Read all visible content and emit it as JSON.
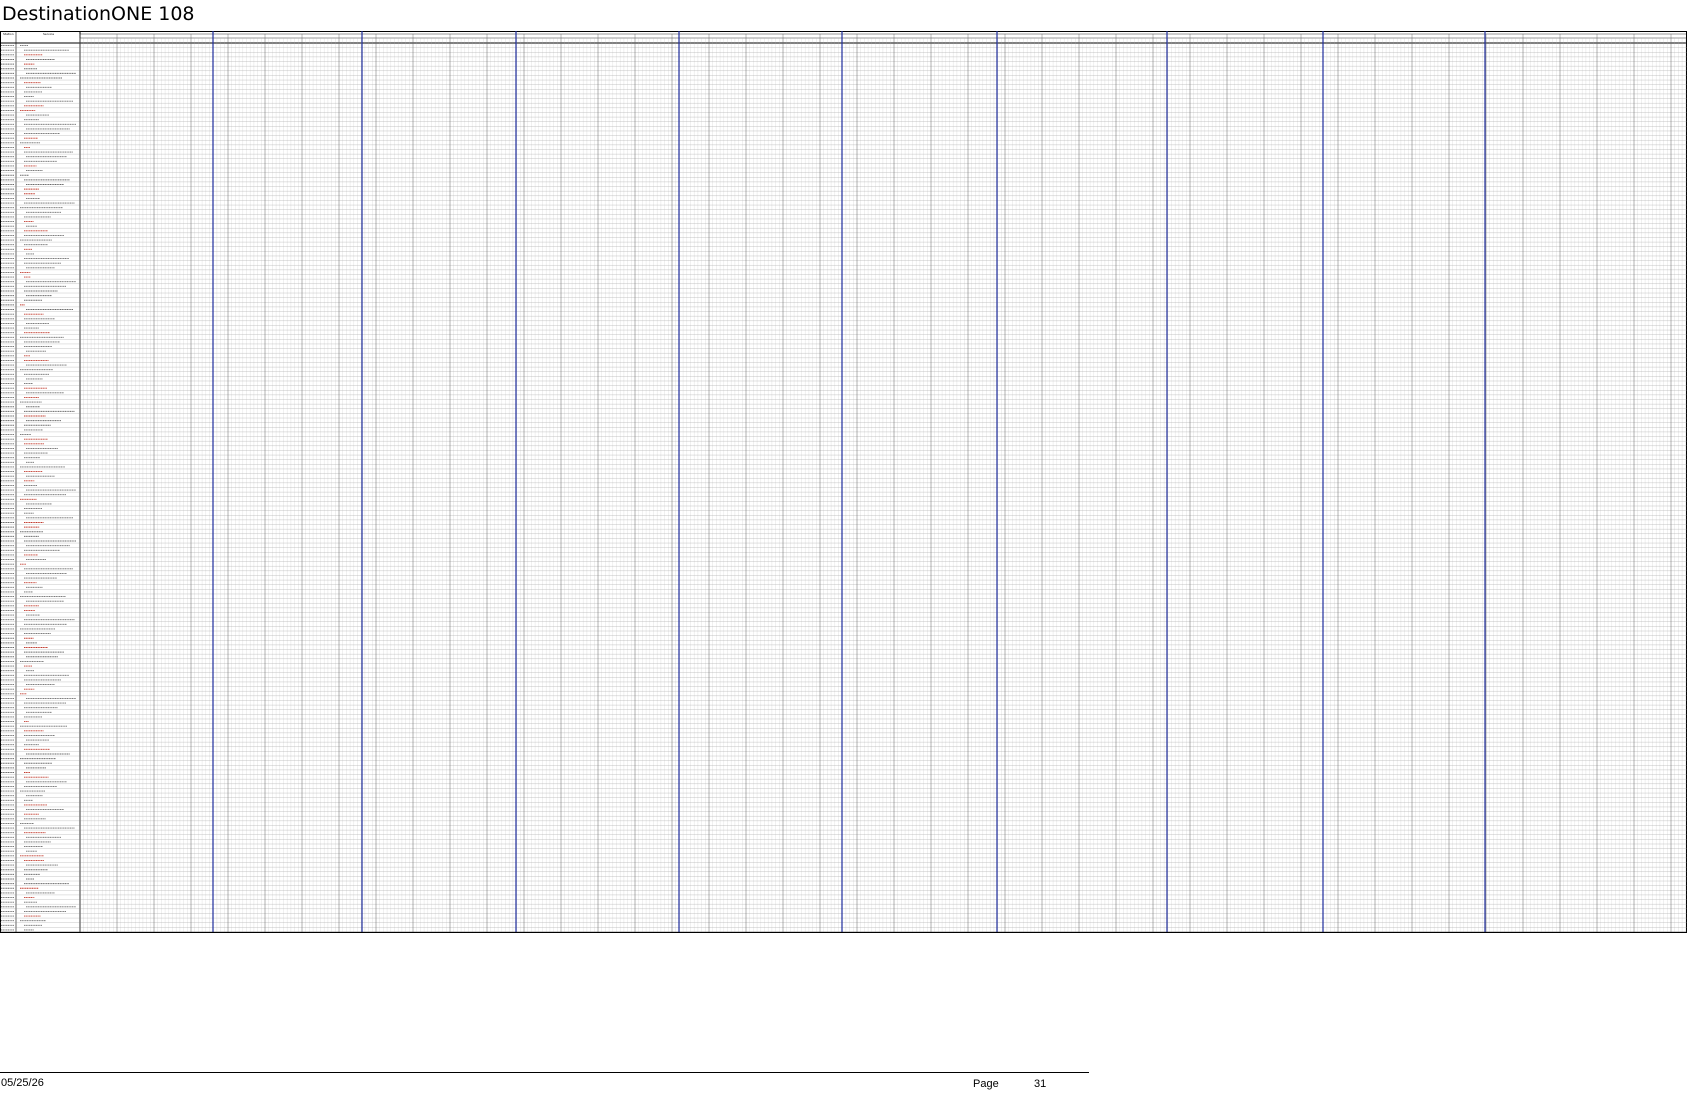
{
  "document": {
    "title": "DestinationONE 108"
  },
  "schedule_grid": {
    "header_left": "Station",
    "header_right": "Service",
    "line_color": "#000000",
    "week_divider_color": "#1f2d9c",
    "highlight_text_color": "#c0392b"
  },
  "footer": {
    "date": "05/25/26",
    "page_label": "Page",
    "page_number": "31"
  }
}
